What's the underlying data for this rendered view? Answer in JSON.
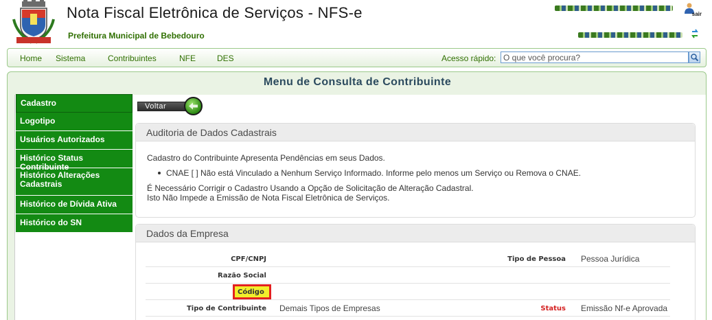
{
  "header": {
    "title": "Nota Fiscal Eletrônica de Serviços - NFS-e",
    "prefeitura": "Prefeitura Municipal de Bebedouro",
    "sair": "sair",
    "crest_icon": "municipal-crest-icon",
    "user_icon": "user-icon",
    "refresh_icon": "refresh-icon"
  },
  "nav": {
    "items": [
      "Home",
      "Sistema",
      "Contribuintes",
      "NFE",
      "DES"
    ],
    "acesso_label": "Acesso rápido:",
    "search_placeholder": "O que você procura?"
  },
  "page": {
    "title": "Menu de Consulta de Contribuinte"
  },
  "sidebar": {
    "items": [
      "Cadastro",
      "Logotipo",
      "Usuários Autorizados",
      "Histórico Status Contribuinte",
      "Histórico Alterações Cadastrais",
      "Histórico de Dívida Ativa",
      "Histórico do SN"
    ]
  },
  "voltar": {
    "label": "Voltar"
  },
  "auditoria": {
    "title": "Auditoria de Dados Cadastrais",
    "intro": "Cadastro do Contribuinte Apresenta Pendências em seus Dados.",
    "bullet": "CNAE [              ] Não está Vinculado a Nenhum Serviço Informado. Informe pelo menos um Serviço ou Remova o CNAE.",
    "line1": "É Necessário Corrigir o Cadastro Usando a Opção de Solicitação de Alteração Cadastral.",
    "line2": "Isto Não Impede a Emissão de Nota Fiscal Eletrônica de Serviços."
  },
  "empresa": {
    "title": "Dados da Empresa",
    "cpf_label": "CPF/CNPJ",
    "tipo_pessoa_label": "Tipo de Pessoa",
    "tipo_pessoa_value": "Pessoa Jurídica",
    "razao_label": "Razão Social",
    "codigo_label": "Código",
    "tipo_contrib_label": "Tipo de Contribuinte",
    "tipo_contrib_value": "Demais Tipos de Empresas",
    "status_label": "Status",
    "status_value": "Emissão Nf-e Aprovada"
  },
  "colors": {
    "sidebar_bg": "#138a13",
    "brand_green": "#2f6f00",
    "highlight_yellow": "#f2ee2b",
    "highlight_border": "#e32020",
    "status_red": "#d42020"
  }
}
